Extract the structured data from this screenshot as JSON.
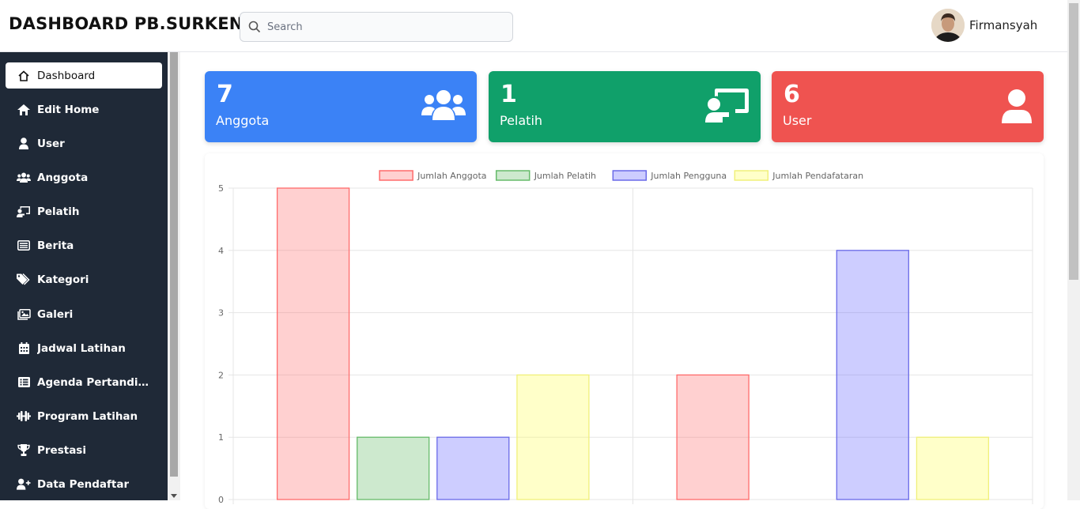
{
  "header": {
    "brand": "DASHBOARD PB.SURKEN",
    "search_placeholder": "Search",
    "user_name": "Firmansyah"
  },
  "sidebar": {
    "items": [
      {
        "label": "Dashboard",
        "icon": "home-icon",
        "active": true
      },
      {
        "label": "Edit Home",
        "icon": "house-icon"
      },
      {
        "label": "User",
        "icon": "user-icon"
      },
      {
        "label": "Anggota",
        "icon": "users-icon"
      },
      {
        "label": "Pelatih",
        "icon": "chalkboard-user-icon"
      },
      {
        "label": "Berita",
        "icon": "newspaper-icon"
      },
      {
        "label": "Kategori",
        "icon": "tags-icon"
      },
      {
        "label": "Galeri",
        "icon": "images-icon"
      },
      {
        "label": "Jadwal Latihan",
        "icon": "calendar-icon"
      },
      {
        "label": "Agenda Pertandingan",
        "icon": "list-icon"
      },
      {
        "label": "Program Latihan",
        "icon": "dumbbell-icon"
      },
      {
        "label": "Prestasi",
        "icon": "trophy-icon"
      },
      {
        "label": "Data Pendaftar",
        "icon": "user-plus-icon"
      }
    ]
  },
  "cards": [
    {
      "value": "7",
      "label": "Anggota",
      "color": "#3b82f6",
      "icon": "users-icon"
    },
    {
      "value": "1",
      "label": "Pelatih",
      "color": "#10a06a",
      "icon": "chalkboard-user-icon"
    },
    {
      "value": "6",
      "label": "User",
      "color": "#ef5350",
      "icon": "user-icon"
    }
  ],
  "chart_data": {
    "type": "bar",
    "categories": [
      "",
      ""
    ],
    "series": [
      {
        "name": "Jumlah Anggota",
        "values": [
          5,
          2
        ],
        "fill": "rgba(255,99,99,0.3)",
        "stroke": "#ff6b6b"
      },
      {
        "name": "Jumlah Pelatih",
        "values": [
          1,
          0
        ],
        "fill": "rgba(76,175,80,0.28)",
        "stroke": "#66bb6a"
      },
      {
        "name": "Jumlah Pengguna",
        "values": [
          1,
          4
        ],
        "fill": "rgba(99,99,255,0.32)",
        "stroke": "#6a6ae8"
      },
      {
        "name": "Jumlah Pendafataran",
        "values": [
          2,
          1
        ],
        "fill": "rgba(255,255,100,0.35)",
        "stroke": "#f0f07a"
      }
    ],
    "yticks": [
      0,
      1,
      2,
      3,
      4,
      5
    ],
    "ylim": [
      0,
      5
    ],
    "legend": "top"
  }
}
